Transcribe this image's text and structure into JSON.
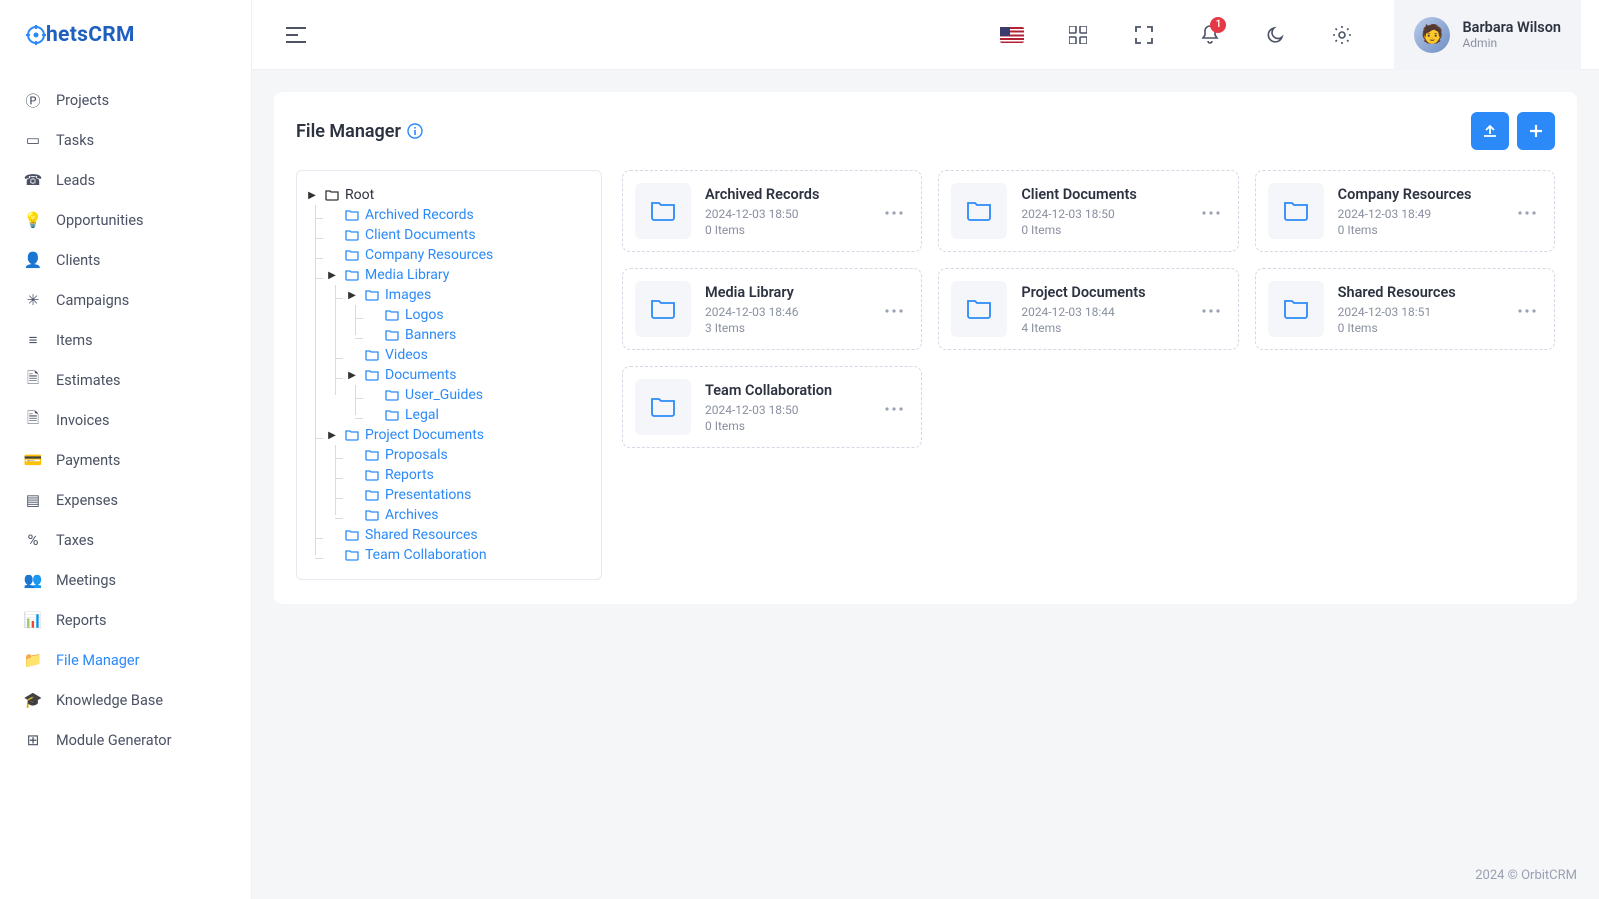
{
  "brand": "hetsCRM",
  "user": {
    "name": "Barbara Wilson",
    "role": "Admin"
  },
  "notifications": {
    "count": "1"
  },
  "page": {
    "title": "File Manager"
  },
  "nav": [
    {
      "label": "Projects",
      "icon": "Ⓟ"
    },
    {
      "label": "Tasks",
      "icon": "▭"
    },
    {
      "label": "Leads",
      "icon": "☎"
    },
    {
      "label": "Opportunities",
      "icon": "💡"
    },
    {
      "label": "Clients",
      "icon": "👤"
    },
    {
      "label": "Campaigns",
      "icon": "✳"
    },
    {
      "label": "Items",
      "icon": "≡"
    },
    {
      "label": "Estimates",
      "icon": "🗎"
    },
    {
      "label": "Invoices",
      "icon": "🗎"
    },
    {
      "label": "Payments",
      "icon": "💳"
    },
    {
      "label": "Expenses",
      "icon": "▤"
    },
    {
      "label": "Taxes",
      "icon": "%"
    },
    {
      "label": "Meetings",
      "icon": "👥"
    },
    {
      "label": "Reports",
      "icon": "📊"
    },
    {
      "label": "File Manager",
      "icon": "📁",
      "active": true
    },
    {
      "label": "Knowledge Base",
      "icon": "🎓"
    },
    {
      "label": "Module Generator",
      "icon": "⊞"
    }
  ],
  "tree": {
    "root": "Root",
    "nodes": {
      "archived_records": "Archived Records",
      "client_documents": "Client Documents",
      "company_resources": "Company Resources",
      "media_library": "Media Library",
      "images": "Images",
      "logos": "Logos",
      "banners": "Banners",
      "videos": "Videos",
      "documents": "Documents",
      "user_guides": "User_Guides",
      "legal": "Legal",
      "project_documents": "Project Documents",
      "proposals": "Proposals",
      "reports": "Reports",
      "presentations": "Presentations",
      "archives": "Archives",
      "shared_resources": "Shared Resources",
      "team_collaboration": "Team Collaboration"
    }
  },
  "folders": [
    {
      "name": "Archived Records",
      "date": "2024-12-03 18:50",
      "items": "0 Items"
    },
    {
      "name": "Client Documents",
      "date": "2024-12-03 18:50",
      "items": "0 Items"
    },
    {
      "name": "Company Resources",
      "date": "2024-12-03 18:49",
      "items": "0 Items"
    },
    {
      "name": "Media Library",
      "date": "2024-12-03 18:46",
      "items": "3 Items"
    },
    {
      "name": "Project Documents",
      "date": "2024-12-03 18:44",
      "items": "4 Items"
    },
    {
      "name": "Shared Resources",
      "date": "2024-12-03 18:51",
      "items": "0 Items"
    },
    {
      "name": "Team Collaboration",
      "date": "2024-12-03 18:50",
      "items": "0 Items"
    }
  ],
  "footer": "2024 © OrbitCRM"
}
